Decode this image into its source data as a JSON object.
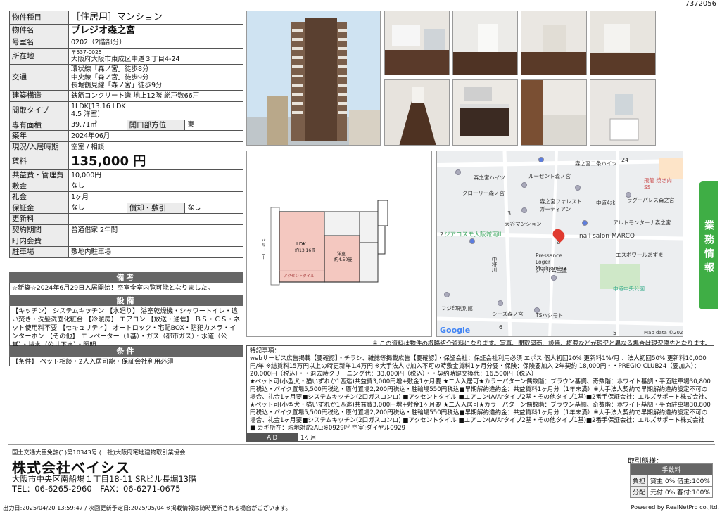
{
  "doc_id": "7372056",
  "spec": {
    "rows": [
      {
        "k": "物件種目",
        "v": "［住居用］マンション",
        "big": true
      },
      {
        "k": "物件名",
        "v": "プレジオ森之宮",
        "big": true,
        "bold": true
      },
      {
        "k": "号室名",
        "v": "0202（2階部分）"
      },
      {
        "k": "所在地",
        "v_small": "〒537-0025",
        "v": "大阪府大阪市東成区中道３丁目4-24"
      },
      {
        "k": "交通",
        "v": "環状線「森ノ宮」徒歩8分|中央線「森ノ宮」徒歩9分|長堀鶴見線「森ノ宮」徒歩9分"
      },
      {
        "k": "建築構造",
        "v": "鉄筋コンクリート造 地上12階 総戸数66戸"
      },
      {
        "k": "間取タイプ",
        "v": "1LDK[13.16 LDK | 4.5 洋室]"
      }
    ],
    "area": {
      "k": "専有面積",
      "v": "39.71㎡",
      "k2": "開口部方位",
      "v2": "東"
    },
    "rows2": [
      {
        "k": "築年",
        "v": "2024年06月"
      },
      {
        "k": "現況/入居時期",
        "v": "空室 / 相談"
      },
      {
        "k": "賃料",
        "v": "135,000 円",
        "rent": true
      },
      {
        "k": "共益費・管理費",
        "v": "10,000円"
      },
      {
        "k": "敷金",
        "v": "なし"
      },
      {
        "k": "礼金",
        "v": "1ヶ月"
      }
    ],
    "deposit": {
      "k": "保証金",
      "v": "なし",
      "k2": "償却・敷引",
      "v2": "なし"
    },
    "rows3": [
      {
        "k": "更新料",
        "v": ""
      },
      {
        "k": "契約期間",
        "v": "普通借家 2年間"
      },
      {
        "k": "町内会費",
        "v": ""
      },
      {
        "k": "駐車場",
        "v": "敷地内駐車場"
      }
    ]
  },
  "biko": {
    "title": "備考",
    "text": "☆新築☆2024年6月29日入居開始！空室全室内覧可能となりました。"
  },
  "setsubi": {
    "title": "設備",
    "text": "【キッチン】 システムキッチン 【水廻り】 浴室乾燥機・シャワートイレ・追い焚き・洗髪洗面化粧台 【冷暖房】 エアコン 【放送・通信】 ＢＳ・ＣＳ・ネット使用料不要 【セキュリティ】 オートロック・宅配BOX・防犯カメラ・インターホン 【その他】 エレベーター（1基）・ガス（都市ガス）・水道（公営）・排水（公共下水）・照明"
  },
  "joken": {
    "title": "条件",
    "text": "【条件】 ペット相談・2人入居可能・保証会社利用必須"
  },
  "floorplan": {
    "balcony": "バルコニー",
    "ldk": "LDK",
    "ldk_size": "約13.16畳",
    "yoshitsu": "洋室",
    "yoshitsu_size": "約4.50畳",
    "accent": "アクセントタイル"
  },
  "map": {
    "labels": [
      "森之宮ハイツ",
      "ルーセント森ノ宮",
      "グローリー森ノ宮",
      "森之宮フォレスト ガーディアン",
      "大谷マンション",
      "ジアコスモ大阪城南II",
      "nail salon MARCO",
      "Pressance Loger Morinomiya",
      "シャルム玉造",
      "エスポワールあずま",
      "中道中央公園",
      "フジ印刷別館",
      "シーズ森ノ宮",
      "TSハシモト",
      "ラグーパレス森之宮",
      "アルトモンターナ森之宮",
      "森之宮二条ハイツ",
      "中将川",
      "飛龍 焼き肉 SS",
      "中道4北",
      "24",
      "2",
      "3",
      "4",
      "5",
      "6"
    ],
    "google": "Google",
    "credit": "Map data ©2024"
  },
  "side_label": "業務情報",
  "notice": "※ この資料は物件の概略紹介資料になります。写真、間取図面、設備、概要などが現況と異なる場合は現況優先となります。",
  "remarks_title": "特記事項：",
  "remarks": "webサービス広告掲載【要確認】・チラシ、雑誌等掲載広告【要確認】・保証会社：保証会社利用必須 エポス 個人初回20% 更新料1%/月 、法人初回50% 更新料10,000円/年 ※総賃料15万円以上の時更新年1.4万円 ※大手法人で加入不可の時敷金賃料1ヶ月分要・保険：保険要加入 2年契約 18,000円・・PREGIO CLUB24（要加入）：20,000円（税込）・・退去時クリーニング代：33,000円（税込）・・契約時鍵交換代：16,500円（税込）|★ペット可(小型犬・猫いずれか1匹迄)共益費3,000円増+敷金1ヶ月要 ★二人入居可★カラーパターン偶数階：ブラウン基調、奇数階：ホワイト基調・平面駐車場30,800円税込・バイク置場5,500円税込・原付置場2,200円税込・駐輪場550円税込■早期解約違約金：共益賃料1ヶ月分（1年未満）※大手法人契約で早期解約違約設定不可の場合、礼金1ヶ月要■システムキッチン(2口ガスコンロ) ■アクセントタイル ■エアコン(A/Arタイプ2基・その他タイプ1基)■2番手保証会社：エルズサポート株式会社、★ペット可(小型犬・猫いずれか1匹迄)共益費3,000円増+敷金1ヶ月要 ★二人入居可★カラーパターン偶数階：ブラウン基調、奇数階：ホワイト基調・平面駐車場30,800円税込・バイク置場5,500円税込・原付置場2,200円税込・駐輪場550円税込■早期解約違約金：共益賃料1ヶ月分（1年未満）※大手法人契約で早期解約違約設定不可の場合、礼金1ヶ月要■システムキッチン(2口ガスコンロ) ■アクセントタイル ■エアコン(A/Arタイプ2基・その他タイプ1基)■2番手保証会社：エルズサポート株式会社|■ カギ所在：現地対応:AL:※0929呼 空室:ダイヤル0929",
  "ad": {
    "k": "ＡＤ",
    "v": "1ヶ月"
  },
  "footer": {
    "assoc": "国土交通大臣免許(1)第10343号 (一社)大阪府宅地建物取引業協会",
    "company": "株式会社ベイシス",
    "address": "大阪市中央区南船場１丁目18-11 SRビル長堀13階",
    "tel": "TEL：06-6265-2960　FAX：06-6271-0675",
    "torihiki": "取引態様：",
    "fee_title": "手数料",
    "fee_rows": [
      {
        "k": "負担",
        "v": "貸主:0% 借主:100%"
      },
      {
        "k": "分配",
        "v": "元付:0% 客付:100%"
      }
    ]
  },
  "bottom_left": "出力日:2025/04/20 13:59:47 / 次回更新予定日:2025/05/04 ※掲載情報は随時更新される場合がございます。",
  "bottom_right": "Powered by RealNetPro co.,ltd."
}
